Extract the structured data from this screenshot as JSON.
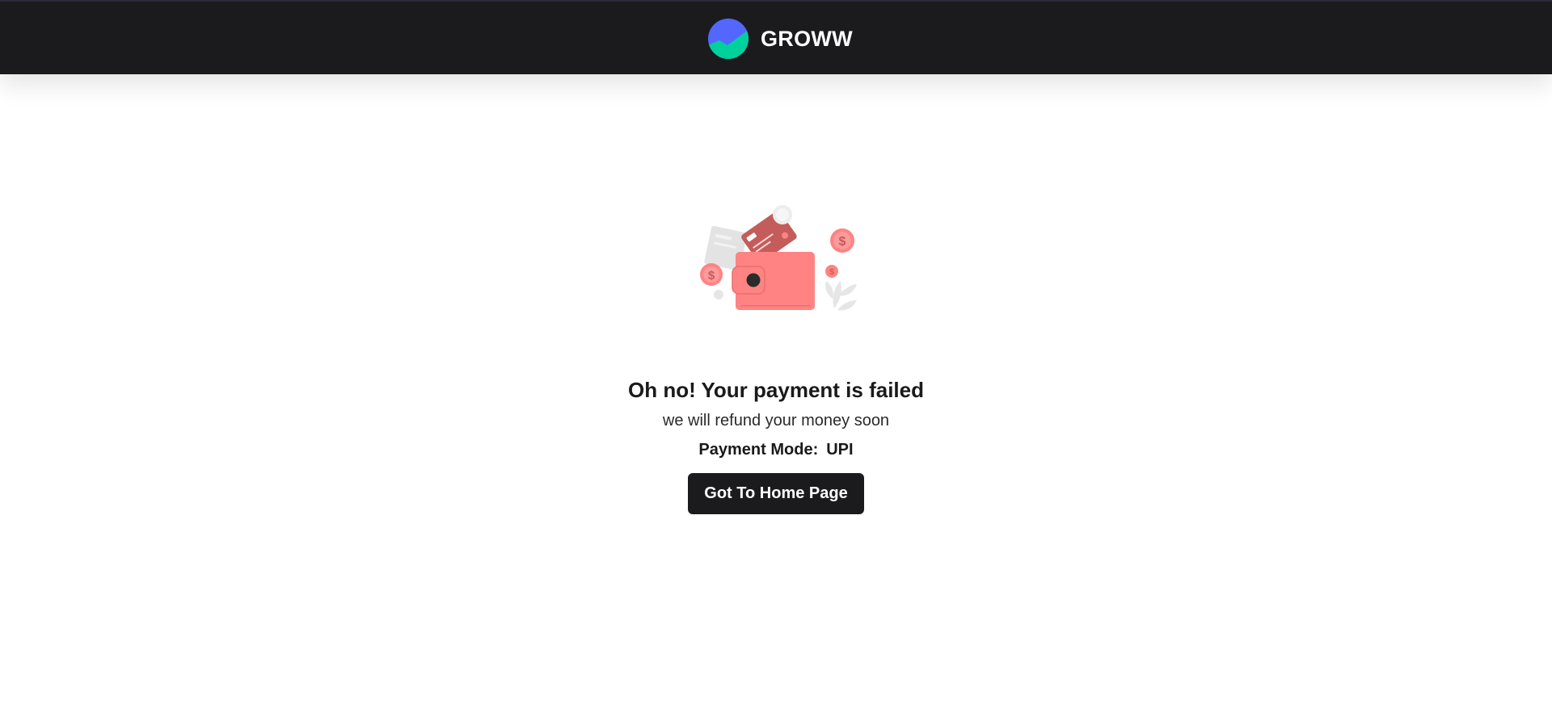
{
  "header": {
    "brand_name": "GROWW",
    "logo_icon": "groww-logo-icon",
    "colors": {
      "bar": "#1b1b1e",
      "logo_top": "#5367ff",
      "logo_bottom": "#00d09c"
    }
  },
  "illustration": {
    "icon": "wallet-cards-coins-icon",
    "colors": {
      "primary": "#ff8383",
      "secondary": "#c45c5c",
      "muted": "#e6e6e6"
    }
  },
  "status": {
    "title": "Oh no! Your payment is failed",
    "subtitle": "we will refund your money soon",
    "payment_mode_label": "Payment Mode:",
    "payment_mode_value": "UPI"
  },
  "actions": {
    "home_button_label": "Got To Home Page"
  }
}
